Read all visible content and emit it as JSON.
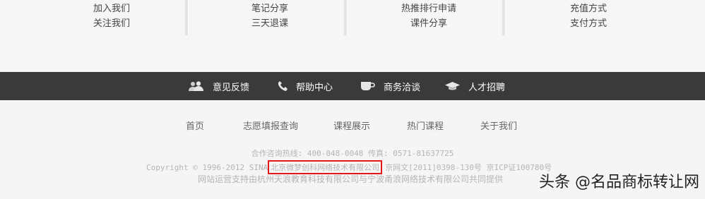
{
  "top_columns": [
    {
      "links": [
        "加入我们",
        "关注我们"
      ]
    },
    {
      "links": [
        "笔记分享",
        "三天退课"
      ]
    },
    {
      "links": [
        "热推排行申请",
        "课件分享"
      ]
    },
    {
      "links": [
        "充值方式",
        "支付方式"
      ]
    }
  ],
  "service_bar": {
    "items": [
      {
        "label": "意见反馈",
        "icon": "users-icon"
      },
      {
        "label": "帮助中心",
        "icon": "phone-icon"
      },
      {
        "label": "商务洽谈",
        "icon": "coffee-cup-icon"
      },
      {
        "label": "人才招聘",
        "icon": "graduation-cap-icon"
      }
    ]
  },
  "footer_nav": [
    "首页",
    "志愿填报查询",
    "课程展示",
    "热门课程",
    "关于我们"
  ],
  "info": {
    "hotline": "合作咨询热线: 400-048-0048  传真: 0571-81637725",
    "copyright_prefix": "Copyright © 1996-2012 SINA",
    "company": "北京微梦创科网络技术有限公司",
    "license": "京网文[2011]0398-130号  京ICP证100780号",
    "support": "网站运营支持由杭州天浪教育科技有限公司与宁波甬浪网络技术有限公司共同提供"
  },
  "watermark": "头条 @名品商标转让网",
  "colors": {
    "bar": "#3a3a3a",
    "highlight_box": "#e01818"
  }
}
